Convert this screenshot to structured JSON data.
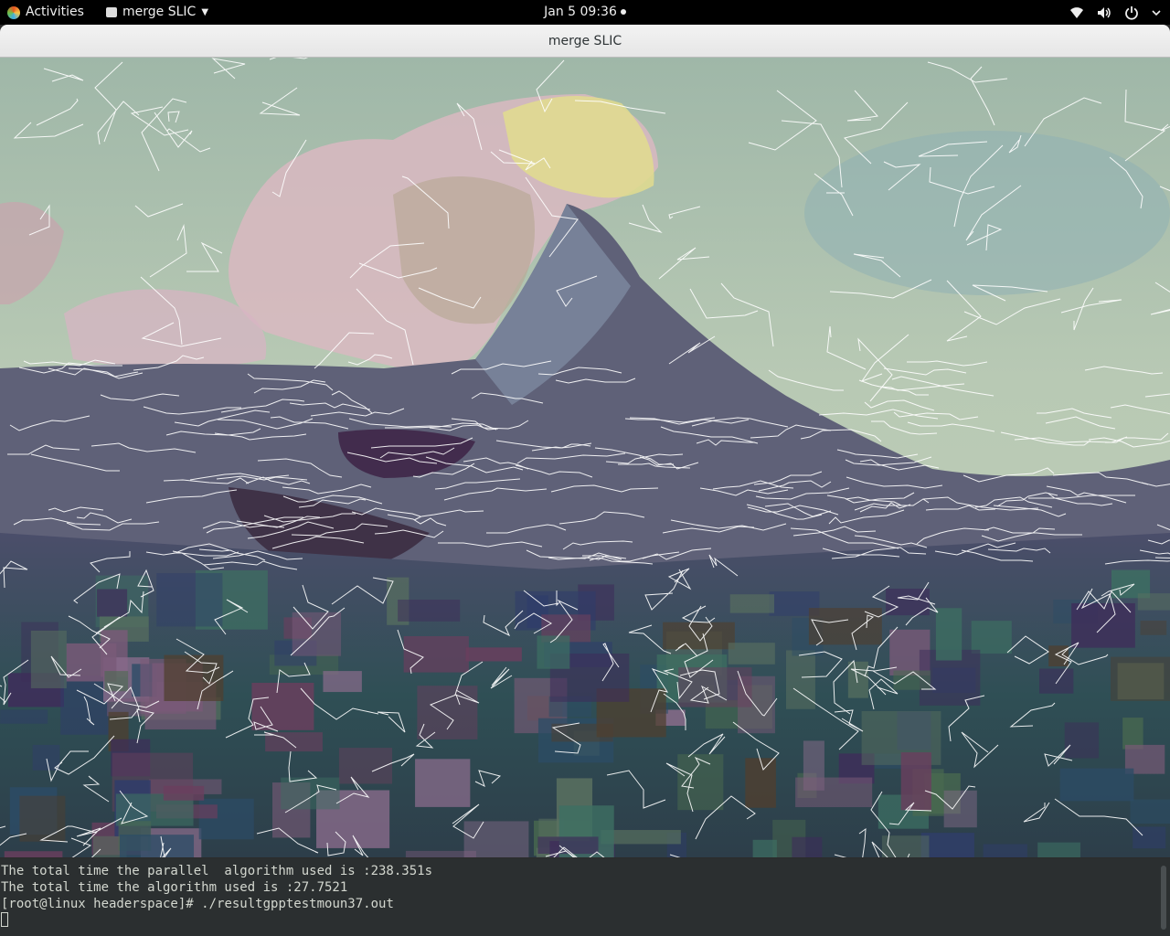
{
  "topbar": {
    "activities": "Activities",
    "app_name": "merge SLIC",
    "clock": "Jan 5  09:36"
  },
  "window": {
    "title": "merge SLIC"
  },
  "terminal": {
    "line1": "The total time the parallel  algorithm used is :238.351s",
    "line2": "The total time the algorithm used is :27.7521",
    "prompt": "[root@linux headerspace]# ",
    "command": "./resultgpptestmoun37.out"
  },
  "colors": {
    "sky": "#a9c1b0",
    "mountain": "#5a5e78",
    "meadow": "#2f5a52",
    "terminal_bg": "#2b2f30"
  },
  "icons": [
    "gnome-logo-icon",
    "app-window-icon",
    "chevron-down-icon",
    "wifi-icon",
    "volume-icon",
    "power-icon",
    "power-menu-chevron-icon"
  ]
}
